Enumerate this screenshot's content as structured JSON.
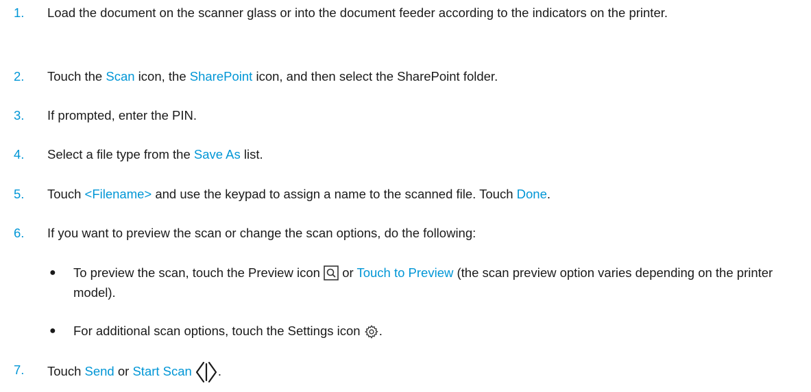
{
  "steps": [
    {
      "number": "1.",
      "text": "Load the document on the scanner glass or into the document feeder according to the indicators on the printer."
    },
    {
      "number": "2.",
      "t1": "Touch the ",
      "h1": "Scan",
      "t2": " icon, the ",
      "h2": "SharePoint",
      "t3": " icon, and then select the SharePoint folder."
    },
    {
      "number": "3.",
      "text": "If prompted, enter the PIN."
    },
    {
      "number": "4.",
      "t1": "Select a file type from the ",
      "h1": "Save As",
      "t2": " list."
    },
    {
      "number": "5.",
      "t1": "Touch ",
      "h1": "<Filename>",
      "t2": " and use the keypad to assign a name to the scanned file. Touch ",
      "h2": "Done",
      "t3": "."
    },
    {
      "number": "6.",
      "text": "If you want to preview the scan or change the scan options, do the following:",
      "bullets": [
        {
          "bullet": "●",
          "t1": "To preview the scan, touch the Preview icon ",
          "icon": "preview-icon",
          "t2": " or ",
          "h1": "Touch to Preview",
          "t3": " (the scan preview option varies depending on the printer model)."
        },
        {
          "bullet": "●",
          "t1": "For additional scan options, touch the Settings icon ",
          "icon": "settings-gear-icon",
          "t2": "."
        }
      ]
    },
    {
      "number": "7.",
      "t1": "Touch ",
      "h1": "Send",
      "t2": " or ",
      "h2": "Start Scan",
      "icon": "start-scan-icon",
      "t3": "."
    }
  ],
  "colors": {
    "accent": "#0096d6",
    "text": "#1a1a1a"
  }
}
